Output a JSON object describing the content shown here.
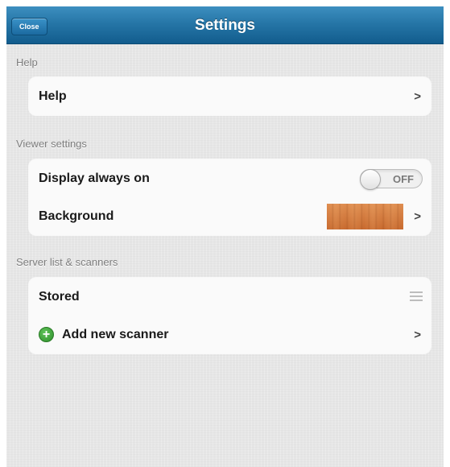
{
  "navbar": {
    "close_label": "Close",
    "title": "Settings"
  },
  "sections": {
    "help": {
      "header": "Help",
      "items": [
        {
          "label": "Help",
          "accessory": "chevron-icon"
        }
      ]
    },
    "viewer": {
      "header": "Viewer settings",
      "display_always_on": {
        "label": "Display always on",
        "toggle_state": "OFF"
      },
      "background": {
        "label": "Background",
        "swatch": "wood-texture"
      }
    },
    "servers": {
      "header": "Server list & scanners",
      "stored": {
        "label": "Stored",
        "accessory": "drag-handle-icon"
      },
      "add_scanner": {
        "label": "Add new scanner",
        "icon": "add-icon"
      }
    }
  },
  "colors": {
    "navbar": "#2676a7",
    "background": "#e6e6e6",
    "add_icon": "#3a9a35"
  }
}
